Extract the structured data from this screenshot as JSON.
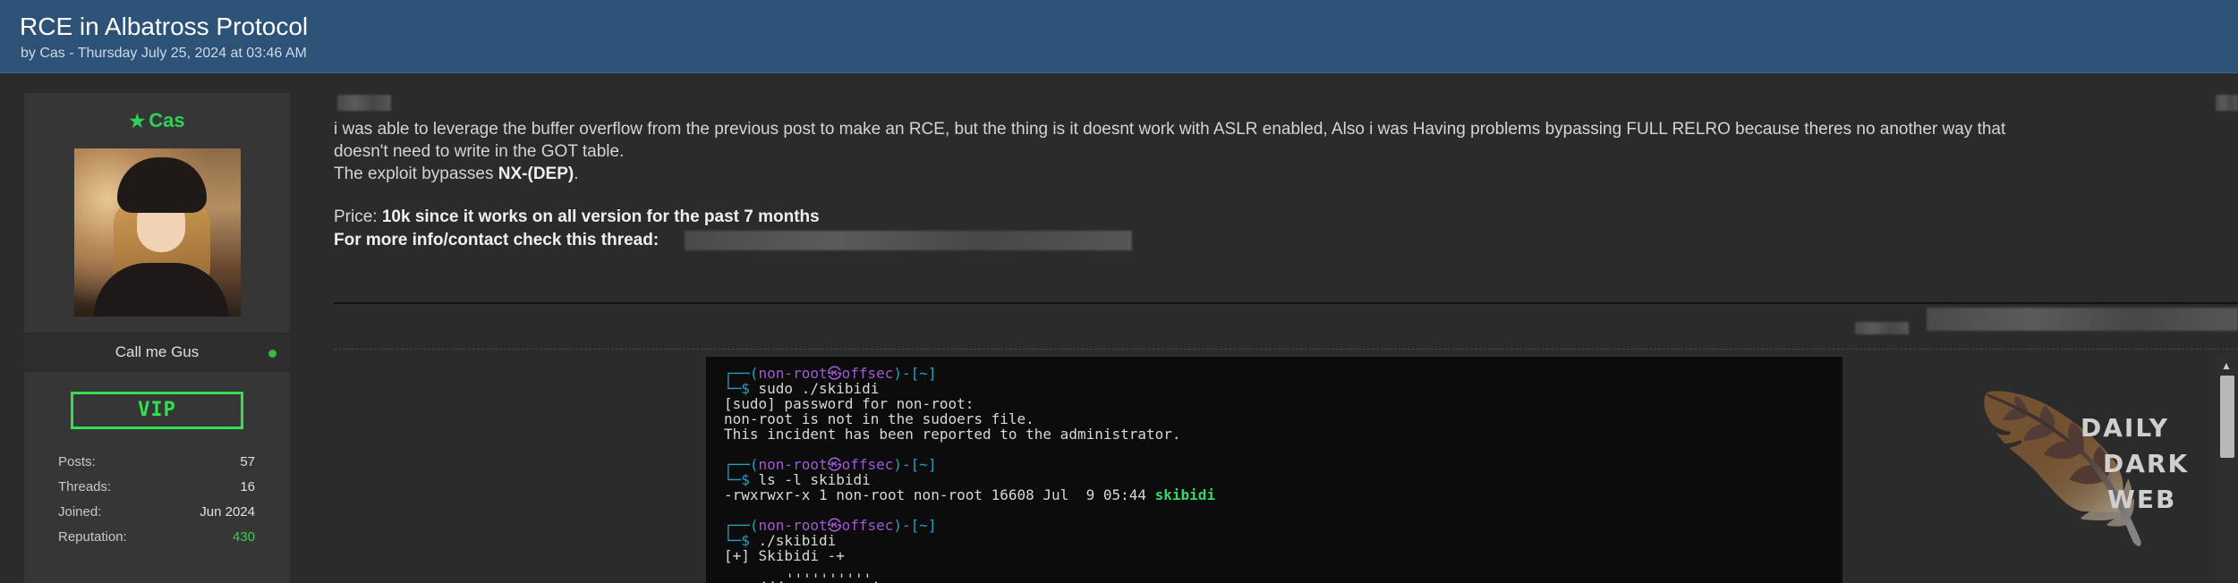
{
  "thread": {
    "title": "RCE in Albatross Protocol",
    "byline": "by Cas - Thursday July 25, 2024 at 03:46 AM"
  },
  "author": {
    "star_icon": "star-icon",
    "username": "Cas",
    "custom_title": "Call me Gus",
    "status": "online",
    "rank_badge": "VIP",
    "stats": [
      {
        "label": "Posts:",
        "value": "57"
      },
      {
        "label": "Threads:",
        "value": "16"
      },
      {
        "label": "Joined:",
        "value": "Jun 2024"
      },
      {
        "label": "Reputation:",
        "value": "430"
      }
    ]
  },
  "post": {
    "line1": "i was able to leverage the buffer overflow from the previous post to make an RCE, but the thing is it doesnt work with ASLR enabled, Also i was Having problems bypassing FULL RELRO because theres no another way that",
    "line2": "doesn't need to write in the GOT table.",
    "line3_prefix": "The exploit bypasses ",
    "line3_bold": "NX-(DEP)",
    "line3_suffix": ".",
    "price_label": "Price: ",
    "price_value": "10k since it works on all version for the past 7 months",
    "contact_text": "For more info/contact check this thread:"
  },
  "terminal": {
    "prompt_open": "┌──(",
    "prompt_user": "non-root",
    "prompt_at": "㉿",
    "prompt_host": "offsec",
    "prompt_close": ")-[~]",
    "prompt_tail": "└─$ ",
    "cmd1": "sudo ./skibidi",
    "out1": "[sudo] password for non-root:",
    "out2": "non-root is not in the sudoers file.",
    "out3": "This incident has been reported to the administrator.",
    "cmd2": "ls -l skibidi",
    "out4": "-rwxrwxr-x 1 non-root non-root 16608 Jul  9 05:44 ",
    "out4_file": "skibidi",
    "cmd3": "./skibidi",
    "out5": "[+] Skibidi -+",
    "out6": ".,,''''''''''."
  },
  "watermark": {
    "line1": "DAILY",
    "line2": "DARK",
    "line3": "WEB"
  }
}
